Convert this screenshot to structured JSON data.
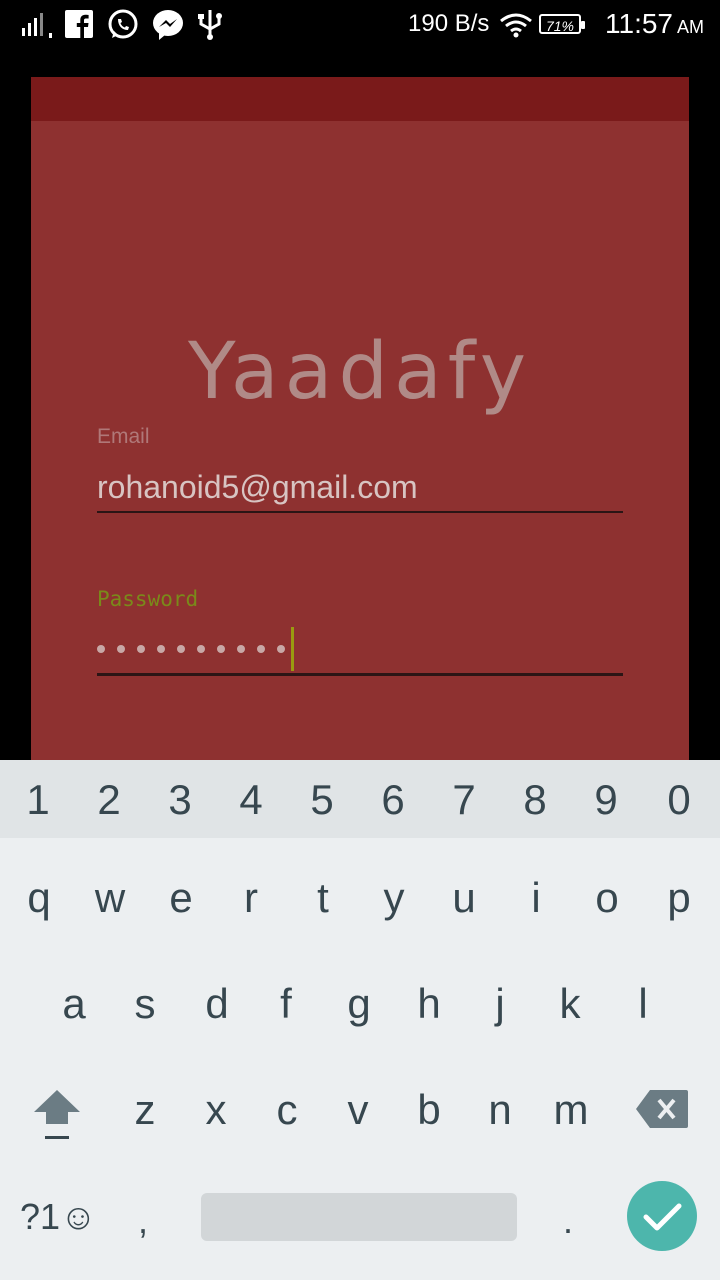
{
  "status_bar": {
    "net_speed": "190 B/s",
    "battery": "71%",
    "time": "11:57",
    "ampm": "AM",
    "icons": [
      "signal-icon",
      "facebook-icon",
      "whatsapp-icon",
      "messenger-icon",
      "usb-icon",
      "wifi-icon",
      "battery-icon"
    ]
  },
  "app": {
    "logo": "Yaadafy",
    "email_label": "Email",
    "email_value": "rohanoid5@gmail.com",
    "password_label": "Password",
    "password_mask": "••••••••••",
    "colors": {
      "background": "#8e3130",
      "topbar": "#7a1a1a",
      "password_label": "#7a8a1a"
    }
  },
  "keyboard": {
    "numbers": [
      "1",
      "2",
      "3",
      "4",
      "5",
      "6",
      "7",
      "8",
      "9",
      "0"
    ],
    "row1": [
      "q",
      "w",
      "e",
      "r",
      "t",
      "y",
      "u",
      "i",
      "o",
      "p"
    ],
    "row2": [
      "a",
      "s",
      "d",
      "f",
      "g",
      "h",
      "j",
      "k",
      "l"
    ],
    "row3": [
      "z",
      "x",
      "c",
      "v",
      "b",
      "n",
      "m"
    ],
    "symbols_label": "?1☺",
    "comma": ",",
    "period": ".",
    "accent_color": "#4db6ac"
  }
}
